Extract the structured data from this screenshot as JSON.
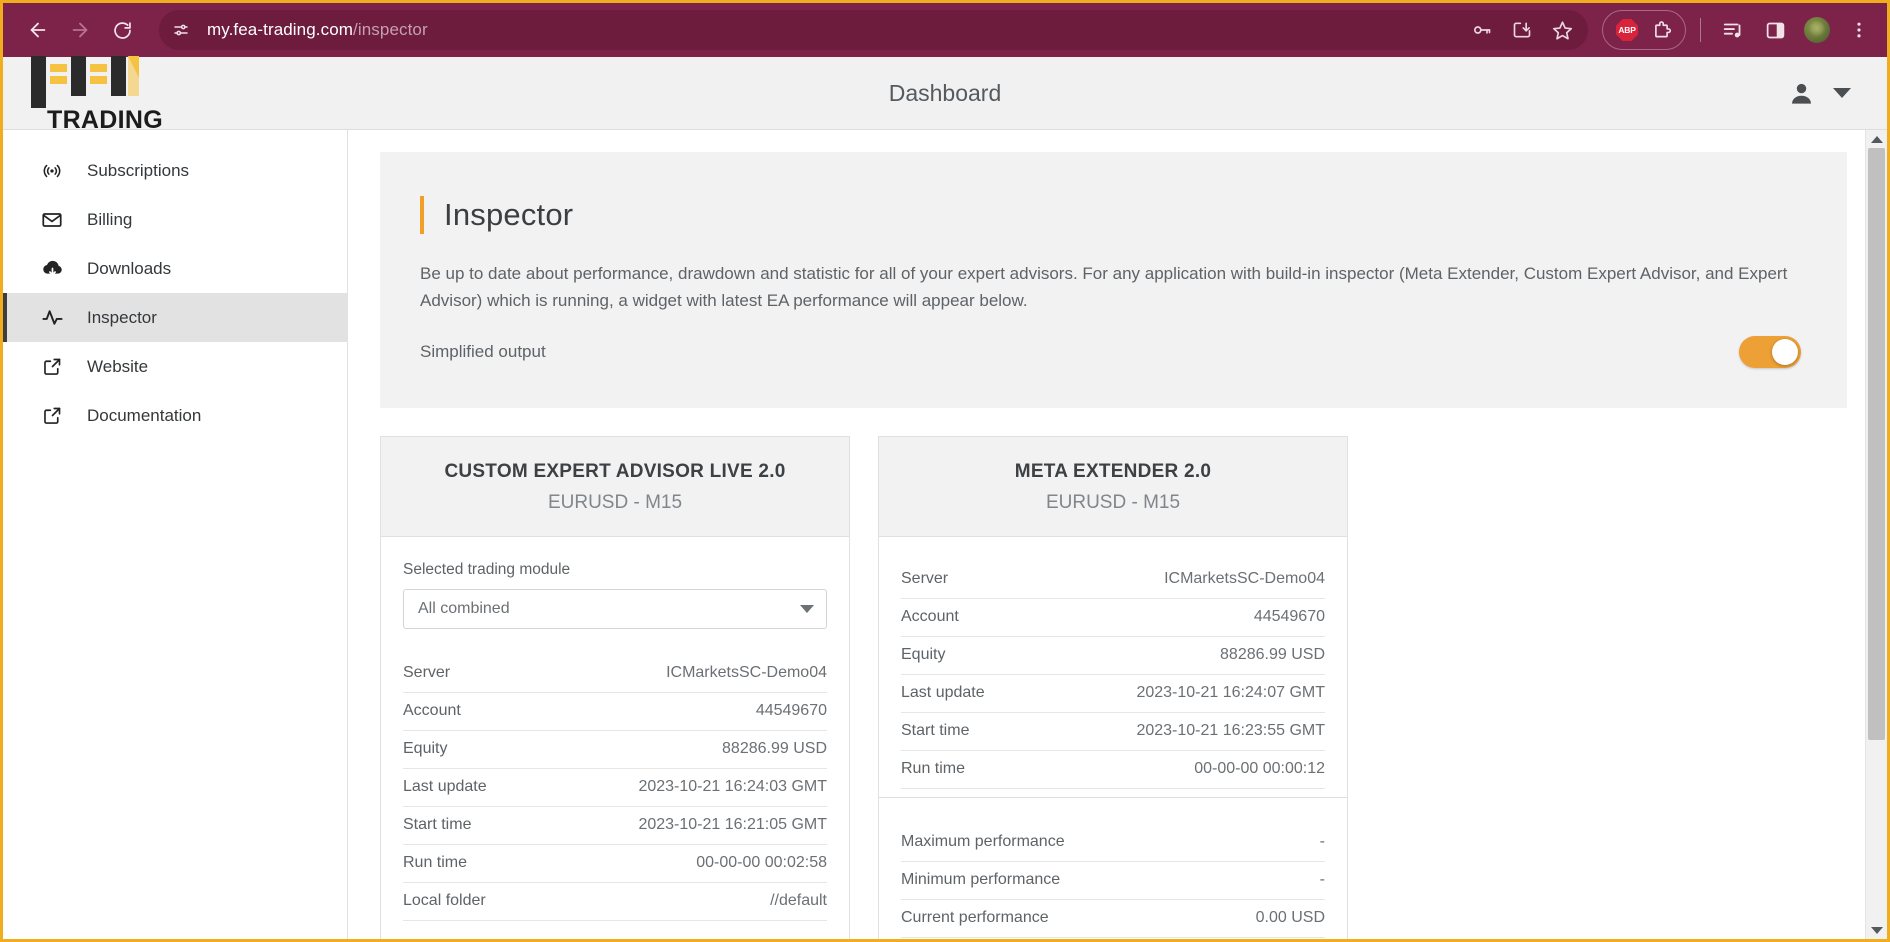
{
  "browser": {
    "back_icon": "back-arrow-icon",
    "forward_icon": "forward-arrow-icon",
    "reload_icon": "reload-icon",
    "site_info_icon": "site-settings-icon",
    "url_host": "my.fea-trading.com",
    "url_path": "/inspector",
    "omnibox_icons": [
      "password-key-icon",
      "install-app-icon",
      "bookmark-star-icon"
    ],
    "extensions": {
      "abp_label": "ABP",
      "puzzle_icon": "extensions-puzzle-icon"
    },
    "right_icons": [
      "media-playlist-icon",
      "side-panel-icon",
      "profile-avatar",
      "chrome-menu-icon"
    ],
    "accent_color": "#7d2248"
  },
  "header": {
    "brand_name": "TRADING",
    "title": "Dashboard",
    "user_icon": "user-account-icon",
    "chevron_icon": "chevron-down-icon"
  },
  "sidebar": {
    "items": [
      {
        "label": "Subscriptions",
        "icon": "broadcast-icon",
        "active": false
      },
      {
        "label": "Billing",
        "icon": "envelope-icon",
        "active": false
      },
      {
        "label": "Downloads",
        "icon": "cloud-download-icon",
        "active": false
      },
      {
        "label": "Inspector",
        "icon": "activity-pulse-icon",
        "active": true
      },
      {
        "label": "Website",
        "icon": "external-link-icon",
        "active": false
      },
      {
        "label": "Documentation",
        "icon": "external-link-icon",
        "active": false
      }
    ]
  },
  "intro": {
    "title": "Inspector",
    "accent_color": "#f0a028",
    "description": "Be up to date about performance, drawdown and statistic for all of your expert advisors. For any application with build-in inspector (Meta Extender, Custom Expert Advisor, and Expert Advisor) which is running, a widget with latest EA performance will appear below.",
    "simplified_output_label": "Simplified output",
    "simplified_output_on": true,
    "toggle_color": "#eda035"
  },
  "cards": [
    {
      "title": "CUSTOM EXPERT ADVISOR LIVE 2.0",
      "subtitle": "EURUSD - M15",
      "module_field_label": "Selected trading module",
      "module_selected": "All combined",
      "has_module_select": true,
      "rows": [
        {
          "key": "Server",
          "value": "ICMarketsSC-Demo04"
        },
        {
          "key": "Account",
          "value": "44549670"
        },
        {
          "key": "Equity",
          "value": "88286.99 USD"
        },
        {
          "key": "Last update",
          "value": "2023-10-21 16:24:03 GMT"
        },
        {
          "key": "Start time",
          "value": "2023-10-21 16:21:05 GMT"
        },
        {
          "key": "Run time",
          "value": "00-00-00 00:02:58"
        },
        {
          "key": "Local folder",
          "value": "//default"
        }
      ],
      "rows2": []
    },
    {
      "title": "META EXTENDER 2.0",
      "subtitle": "EURUSD - M15",
      "has_module_select": false,
      "rows": [
        {
          "key": "Server",
          "value": "ICMarketsSC-Demo04"
        },
        {
          "key": "Account",
          "value": "44549670"
        },
        {
          "key": "Equity",
          "value": "88286.99 USD"
        },
        {
          "key": "Last update",
          "value": "2023-10-21 16:24:07 GMT"
        },
        {
          "key": "Start time",
          "value": "2023-10-21 16:23:55 GMT"
        },
        {
          "key": "Run time",
          "value": "00-00-00 00:00:12"
        }
      ],
      "rows2": [
        {
          "key": "Maximum performance",
          "value": "-"
        },
        {
          "key": "Minimum performance",
          "value": "-"
        },
        {
          "key": "Current performance",
          "value": "0.00 USD"
        }
      ]
    }
  ],
  "scrollbar": {
    "up_icon": "scroll-up-arrow-icon",
    "down_icon": "scroll-down-arrow-icon"
  }
}
